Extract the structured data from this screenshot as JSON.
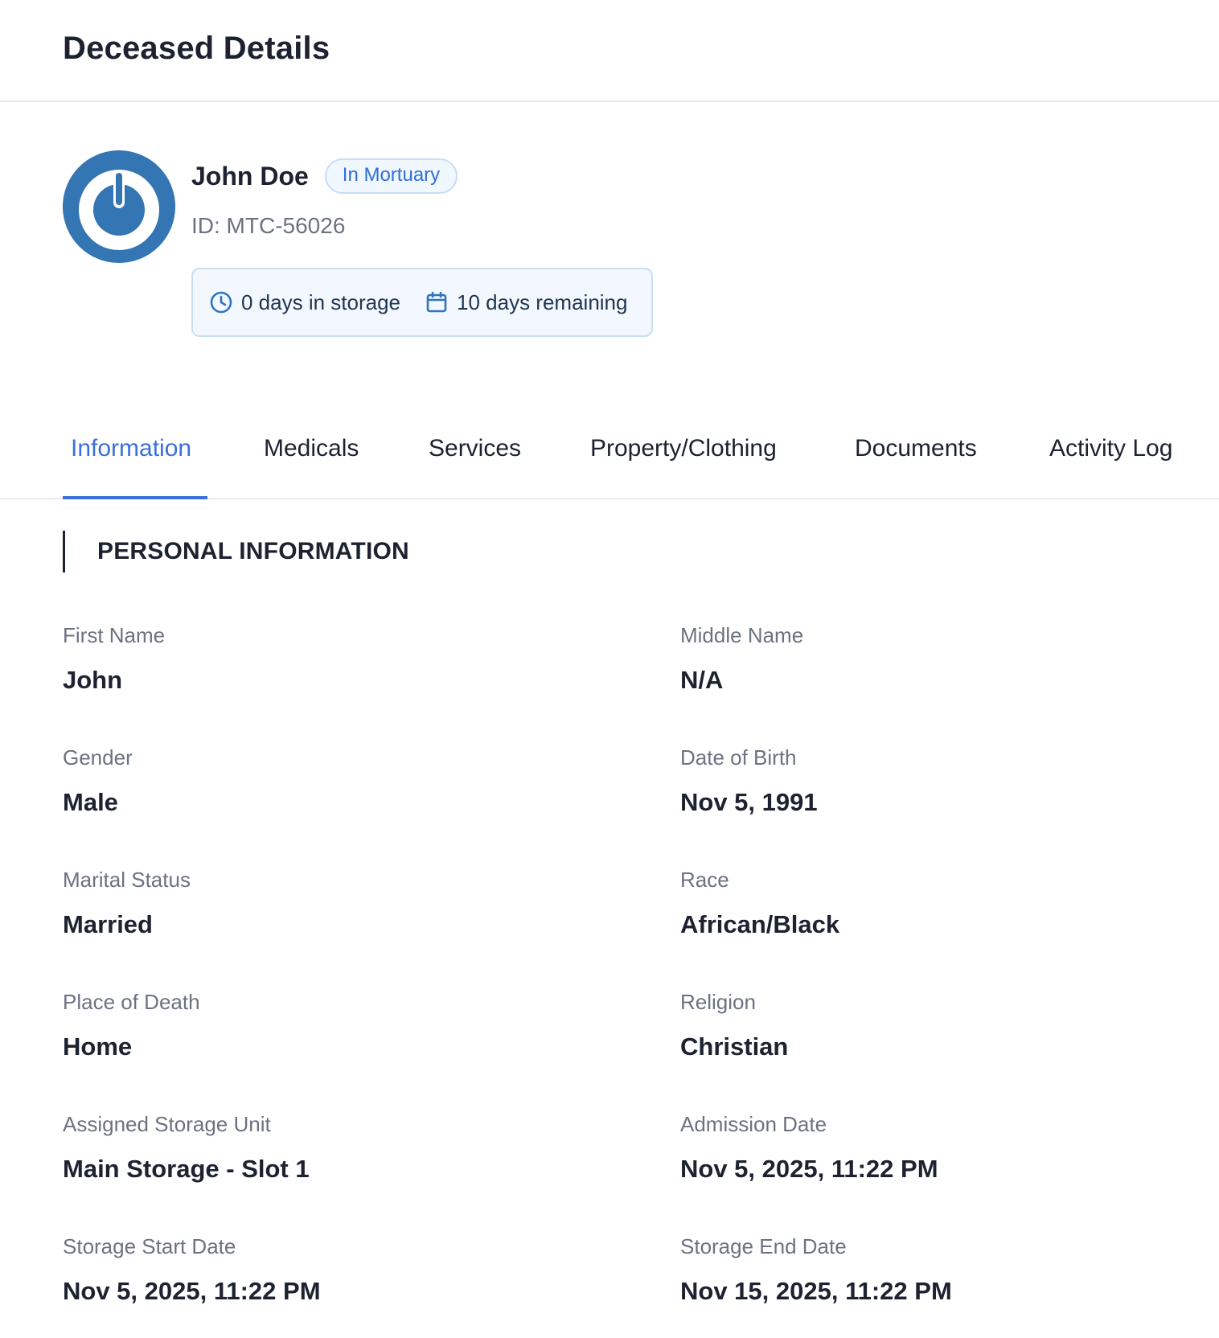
{
  "header": {
    "title": "Deceased Details"
  },
  "profile": {
    "name": "John Doe",
    "status": "In Mortuary",
    "id": "ID: MTC-56026",
    "storage": {
      "days_in_storage": "0 days in storage",
      "days_remaining": "10 days remaining"
    },
    "colors": {
      "avatar": "#3475b4",
      "badge": "#2f6fd6"
    }
  },
  "tabs": [
    {
      "label": "Information",
      "active": true
    },
    {
      "label": "Medicals"
    },
    {
      "label": "Services"
    },
    {
      "label": "Property/Clothing"
    },
    {
      "label": "Documents"
    },
    {
      "label": "Activity Log"
    }
  ],
  "section": {
    "title": "PERSONAL INFORMATION"
  },
  "fields": [
    {
      "label": "First Name",
      "value": "John"
    },
    {
      "label": "Middle Name",
      "value": "N/A"
    },
    {
      "label": "Gender",
      "value": "Male"
    },
    {
      "label": "Date of Birth",
      "value": "Nov 5, 1991"
    },
    {
      "label": "Marital Status",
      "value": "Married"
    },
    {
      "label": "Race",
      "value": "African/Black"
    },
    {
      "label": "Place of Death",
      "value": "Home"
    },
    {
      "label": "Religion",
      "value": "Christian"
    },
    {
      "label": "Assigned Storage Unit",
      "value": "Main Storage - Slot 1"
    },
    {
      "label": "Admission Date",
      "value": "Nov 5, 2025, 11:22 PM"
    },
    {
      "label": "Storage Start Date",
      "value": "Nov 5, 2025, 11:22 PM"
    },
    {
      "label": "Storage End Date",
      "value": "Nov 15, 2025, 11:22 PM"
    }
  ],
  "icons": {
    "clock": "clock-icon",
    "calendar": "calendar-icon",
    "avatar": "power-icon"
  }
}
